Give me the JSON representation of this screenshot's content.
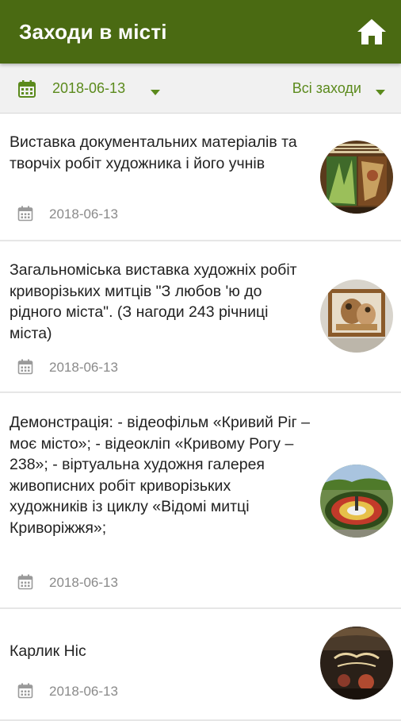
{
  "appbar": {
    "title": "Заходи в місті",
    "home_icon": "home-icon"
  },
  "filters": {
    "date_label": "2018-06-13",
    "type_label": "Всі заходи"
  },
  "colors": {
    "appbar": "#4a6a12",
    "accent": "#5b8a1c",
    "date_text": "#8a8a8a"
  },
  "events": [
    {
      "title": "Виставка документальних матеріалів та творчіх робіт художника і його учнів",
      "date": "2018-06-13"
    },
    {
      "title": "Загальноміська виставка художніх робіт криворізьких митців \"З любов 'ю до рідного міста\". (З нагоди 243 річниці міста)",
      "date": "2018-06-13"
    },
    {
      "title": "Демонстрація: - відеофільм «Кривий Ріг – моє місто»; - відеокліп «Кривому Рогу – 238»; - віртуальна художня галерея живописних робіт криворізьких художників із циклу «Відомі митці Криворіжжя»;",
      "date": "2018-06-13"
    },
    {
      "title": "Карлик Ніс",
      "date": "2018-06-13"
    }
  ]
}
